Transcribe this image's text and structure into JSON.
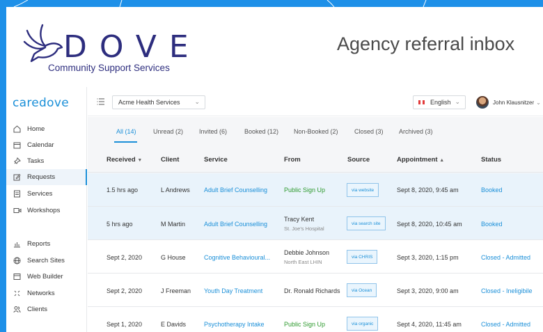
{
  "banner": {
    "logo_word": "DOVE",
    "logo_subtitle": "Community Support Services",
    "title": "Agency referral inbox"
  },
  "app": {
    "brand": "caredove",
    "sidebar": {
      "items": [
        {
          "label": "Home",
          "icon": "home-icon",
          "active": false
        },
        {
          "label": "Calendar",
          "icon": "calendar-icon",
          "active": false
        },
        {
          "label": "Tasks",
          "icon": "pin-icon",
          "active": false
        },
        {
          "label": "Requests",
          "icon": "edit-icon",
          "active": true
        },
        {
          "label": "Services",
          "icon": "list-icon",
          "active": false
        },
        {
          "label": "Workshops",
          "icon": "video-icon",
          "active": false
        },
        {
          "label": "Reports",
          "icon": "bar-chart-icon",
          "active": false
        },
        {
          "label": "Search Sites",
          "icon": "globe-icon",
          "active": false
        },
        {
          "label": "Web Builder",
          "icon": "window-icon",
          "active": false
        },
        {
          "label": "Networks",
          "icon": "network-icon",
          "active": false
        },
        {
          "label": "Clients",
          "icon": "people-icon",
          "active": false
        }
      ]
    },
    "topbar": {
      "organization": "Acme Health Services",
      "language": "English",
      "user": "John Klausnitzer"
    },
    "tabs": [
      "All (14)",
      "Unread (2)",
      "Invited (6)",
      "Booked (12)",
      "Non-Booked (2)",
      "Closed (3)",
      "Archived (3)"
    ],
    "columns": [
      "Received",
      "Client",
      "Service",
      "From",
      "Source",
      "Appointment",
      "Status"
    ],
    "rows": [
      {
        "received": "1.5 hrs ago",
        "client": "L Andrews",
        "service": "Adult Brief Counselling",
        "from": "Public Sign Up",
        "from_sub": "",
        "source": "via website",
        "appointment": "Sept 8, 2020, 9:45 am",
        "status": "Booked",
        "highlight": true
      },
      {
        "received": "5 hrs ago",
        "client": "M Martin",
        "service": "Adult Brief Counselling",
        "from": "Tracy Kent",
        "from_sub": "St. Joe's Hospital",
        "source": "via search site",
        "appointment": "Sept 8, 2020, 10:45 am",
        "status": "Booked",
        "highlight": true
      },
      {
        "received": "Sept 2, 2020",
        "client": "G House",
        "service": "Cognitive Behavioural...",
        "from": "Debbie Johnson",
        "from_sub": "North East LHIN",
        "source": "via CHRIS",
        "appointment": "Sept 3, 2020, 1:15 pm",
        "status": "Closed - Admitted",
        "highlight": false
      },
      {
        "received": "Sept 2, 2020",
        "client": "J Freeman",
        "service": "Youth Day Treatment",
        "from": "Dr. Ronald Richards",
        "from_sub": "",
        "source": "via Ocean",
        "appointment": "Sept 3, 2020, 9:00 am",
        "status": "Closed - Ineligibile",
        "highlight": false
      },
      {
        "received": "Sept 1, 2020",
        "client": "E Davids",
        "service": "Psychotherapy Intake",
        "from": "Public Sign Up",
        "from_sub": "",
        "source": "via organic",
        "appointment": "Sept 4, 2020, 11:45 am",
        "status": "Closed - Admitted",
        "highlight": false
      }
    ]
  },
  "colors": {
    "frame": "#1e90e8",
    "accent": "#1a8fd8",
    "logo": "#2d2d7e",
    "public_signup": "#2e9a2e",
    "highlight_row": "#e9f3fb"
  }
}
